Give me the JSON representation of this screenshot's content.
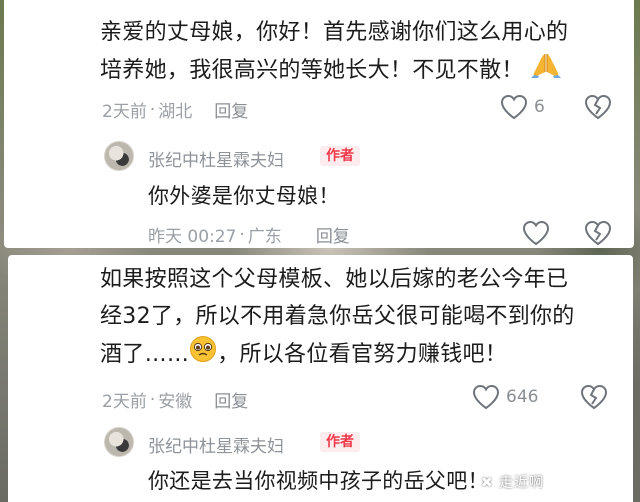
{
  "comments": [
    {
      "lines": [
        "亲爱的丈母娘，你好！首先感谢你们这么用心的",
        "培养她，我很高兴的等她长大！不见不散！"
      ],
      "emoji": "pray-emoji",
      "time": "2天前",
      "location": "湖北",
      "reply_label": "回复",
      "likes": "6",
      "author_reply": {
        "name": "张纪中杜星霖夫妇",
        "badge": "作者",
        "text": "你外婆是你丈母娘！",
        "time": "昨天 00:27",
        "location": "广东",
        "reply_label": "回复"
      }
    },
    {
      "lines": [
        "如果按照这个父母模板、她以后嫁的老公今年已",
        "经32了，所以不用着急你岳父很可能喝不到你的",
        "酒了……",
        "，所以各位看官努力赚钱吧！"
      ],
      "emoji": "pleading-face-emoji",
      "time": "2天前",
      "location": "安徽",
      "reply_label": "回复",
      "likes": "646",
      "author_reply": {
        "name": "张纪中杜星霖夫妇",
        "badge": "作者",
        "text": "你还是去当你视频中孩子的岳父吧！"
      }
    }
  ],
  "watermark": "✖ 走近啊"
}
